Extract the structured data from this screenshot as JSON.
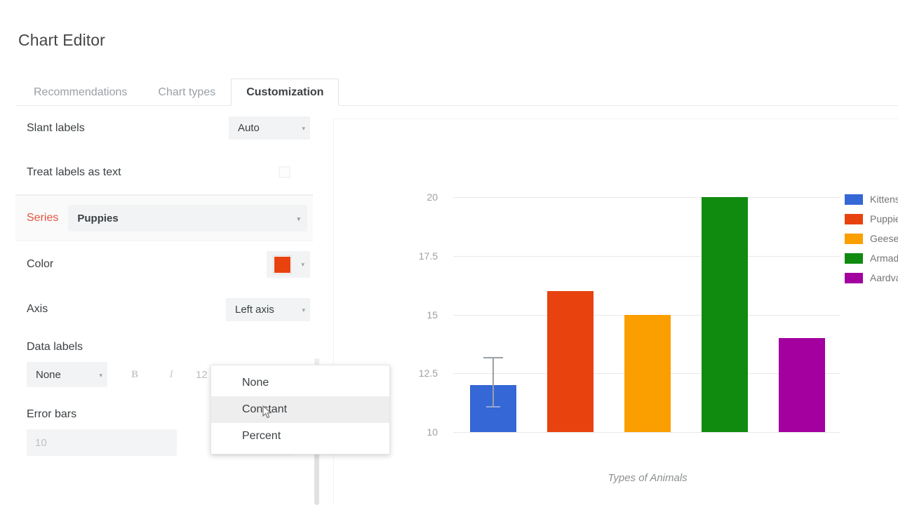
{
  "header": {
    "title": "Chart Editor"
  },
  "tabs": [
    {
      "label": "Recommendations",
      "active": false
    },
    {
      "label": "Chart types",
      "active": false
    },
    {
      "label": "Customization",
      "active": true
    }
  ],
  "settings": {
    "slant_labels": {
      "label": "Slant labels",
      "value": "Auto"
    },
    "treat_labels_as_text": {
      "label": "Treat labels as text",
      "checked": false
    },
    "series": {
      "label": "Series",
      "value": "Puppies"
    },
    "color": {
      "label": "Color",
      "value": "#e8430f"
    },
    "axis": {
      "label": "Axis",
      "value": "Left axis"
    },
    "data_labels": {
      "label": "Data labels",
      "value": "None",
      "bold_label": "B",
      "italic_label": "I",
      "font_size": "12"
    },
    "error_bars": {
      "label": "Error bars",
      "input_placeholder": "10",
      "input_value": "",
      "value": "None"
    },
    "caret_glyph": "▾"
  },
  "dropdown_menu": {
    "items": [
      {
        "label": "None",
        "hovered": false
      },
      {
        "label": "Constant",
        "hovered": true
      },
      {
        "label": "Percent",
        "hovered": false
      }
    ]
  },
  "chart_data": {
    "type": "bar",
    "title": "",
    "xlabel": "Types of Animals",
    "ylabel": "",
    "categories": [
      "Kittens",
      "Puppies",
      "Geese",
      "Armadillos",
      "Aardvarks"
    ],
    "values": [
      12,
      16,
      15,
      20,
      14
    ],
    "colors": [
      "#3567d6",
      "#e8430f",
      "#fb9e00",
      "#108b10",
      "#a3009f"
    ],
    "ylim": [
      10,
      20
    ],
    "yticks": [
      "10",
      "12.5",
      "15",
      "17.5",
      "20"
    ],
    "ytick_values": [
      10,
      12.5,
      15,
      17.5,
      20
    ],
    "grid": true,
    "legend_position": "right",
    "legend_entries": [
      {
        "label": "Kittens",
        "truncated_label": "Kitte",
        "color": "#3567d6"
      },
      {
        "label": "Puppies",
        "truncated_label": "Pupp",
        "color": "#e8430f"
      },
      {
        "label": "Geese",
        "truncated_label": "Gee",
        "color": "#fb9e00"
      },
      {
        "label": "Armadillos",
        "truncated_label": "Arm",
        "color": "#108b10"
      },
      {
        "label": "Aardvarks",
        "truncated_label": "Aard",
        "color": "#a3009f"
      }
    ],
    "error_bars": [
      {
        "category": "Kittens",
        "value": 12,
        "upper": 13.2,
        "lower": 11.1
      }
    ]
  }
}
